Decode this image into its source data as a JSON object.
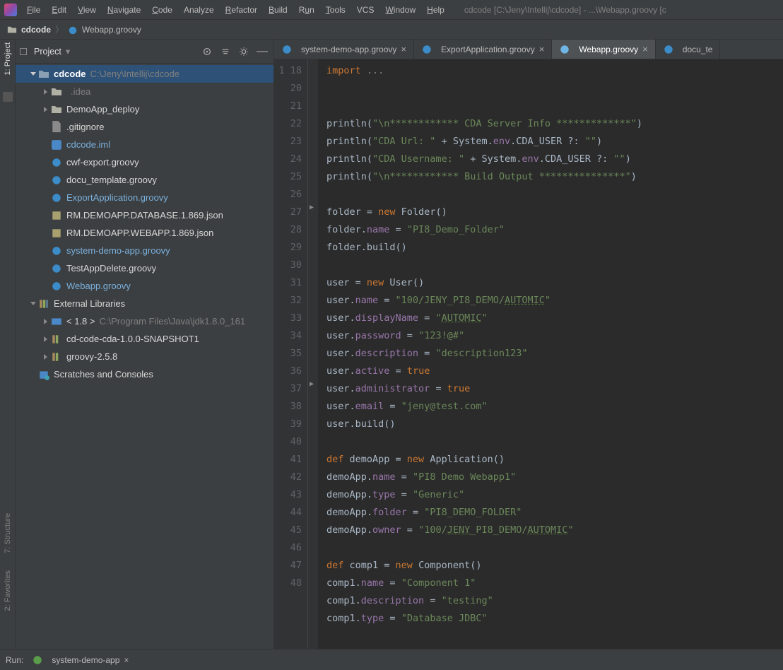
{
  "menu": {
    "file": "File",
    "edit": "Edit",
    "view": "View",
    "navigate": "Navigate",
    "code": "Code",
    "analyze": "Analyze",
    "refactor": "Refactor",
    "build": "Build",
    "run": "Run",
    "tools": "Tools",
    "vcs": "VCS",
    "window": "Window",
    "help": "Help",
    "title_path": "cdcode [C:\\Jeny\\Intellij\\cdcode] - ...\\Webapp.groovy [c"
  },
  "breadcrumb": {
    "project": "cdcode",
    "file": "Webapp.groovy"
  },
  "left_tabs": {
    "project": "1: Project",
    "structure": "7: Structure",
    "favorites": "2: Favorites"
  },
  "project_panel": {
    "title": "Project"
  },
  "tree": {
    "root": {
      "name": "cdcode",
      "path": "C:\\Jeny\\Intellij\\cdcode"
    },
    "items": [
      {
        "label": ".idea",
        "type": "folder",
        "exp": true
      },
      {
        "label": "DemoApp_deploy",
        "type": "folder",
        "exp": true
      },
      {
        "label": ".gitignore",
        "type": "file"
      },
      {
        "label": "cdcode.iml",
        "type": "iml",
        "hl": true
      },
      {
        "label": "cwf-export.groovy",
        "type": "groovy"
      },
      {
        "label": "docu_template.groovy",
        "type": "groovy"
      },
      {
        "label": "ExportApplication.groovy",
        "type": "groovy",
        "hl": true
      },
      {
        "label": "RM.DEMOAPP.DATABASE.1.869.json",
        "type": "json"
      },
      {
        "label": "RM.DEMOAPP.WEBAPP.1.869.json",
        "type": "json"
      },
      {
        "label": "system-demo-app.groovy",
        "type": "groovy",
        "hl": true
      },
      {
        "label": "TestAppDelete.groovy",
        "type": "groovy"
      },
      {
        "label": "Webapp.groovy",
        "type": "groovy",
        "hl": true
      }
    ],
    "ext_lib": "External Libraries",
    "jdk": {
      "pre": "< 1.8 >",
      "path": "C:\\Program Files\\Java\\jdk1.8.0_161"
    },
    "lib1": "cd-code-cda-1.0.0-SNAPSHOT1",
    "lib2": "groovy-2.5.8",
    "scratches": "Scratches and Consoles"
  },
  "tabs": [
    {
      "label": "system-demo-app.groovy"
    },
    {
      "label": "ExportApplication.groovy"
    },
    {
      "label": "Webapp.groovy"
    },
    {
      "label": "docu_te"
    }
  ],
  "lines": [
    "1",
    "18",
    "",
    "20",
    "21",
    "22",
    "23",
    "24",
    "25",
    "26",
    "27",
    "28",
    "29",
    "30",
    "31",
    "32",
    "33",
    "34",
    "35",
    "36",
    "37",
    "38",
    "39",
    "40",
    "41",
    "42",
    "43",
    "44",
    "45",
    "46",
    "47",
    "48"
  ],
  "run": {
    "label": "Run:",
    "config": "system-demo-app"
  },
  "code_txt": {
    "import": "import",
    "dots": "...",
    "p1a": "println(",
    "p1b": "\"\\n************ CDA Server Info *************\"",
    "p2a": "println(",
    "p2b": "\"CDA Url: \"",
    "p2c": " + System.",
    "p2env": "env",
    "p2d": ".CDA_USER ?: ",
    "p2e": "\"\"",
    "p3a": "println(",
    "p3b": "\"CDA Username: \"",
    "p3c": " + System.",
    "p3env": "env",
    "p3d": ".CDA_USER ?: ",
    "p3e": "\"\"",
    "p4a": "println(",
    "p4b": "\"\\n************ Build Output ***************\"",
    "folder_a": "folder = ",
    "new": "new",
    "folder_b": " Folder()",
    "fname_a": "folder.",
    "fname_f": "name",
    "fname_b": " = ",
    "fname_s": "\"PI8_Demo_Folder\"",
    "fbuild": "folder.build()",
    "user_a": "user = ",
    "user_b": " User()",
    "un_a": "user.",
    "un_f": "name",
    "un_b": " = ",
    "un_s": "\"100/JENY_PI8_DEMO/",
    "un_l": "AUTOMIC",
    "un_e": "\"",
    "ud_a": "user.",
    "ud_f": "displayName",
    "ud_b": " = ",
    "ud_s": "\"",
    "ud_l": "AUTOMIC",
    "ud_e": "\"",
    "up_a": "user.",
    "up_f": "password",
    "up_b": " = ",
    "up_s": "\"123!@#\"",
    "ude_a": "user.",
    "ude_f": "description",
    "ude_b": " = ",
    "ude_s": "\"description123\"",
    "ua_a": "user.",
    "ua_f": "active",
    "ua_b": " = ",
    "true": "true",
    "uad_a": "user.",
    "uad_f": "administrator",
    "uad_b": " = ",
    "ue_a": "user.",
    "ue_f": "email",
    "ue_b": " = ",
    "ue_s": "\"jeny@test.com\"",
    "ubuild": "user.build()",
    "def": "def",
    "da_a": " demoApp = ",
    "da_b": " Application()",
    "dan_a": "demoApp.",
    "dan_f": "name",
    "dan_b": " = ",
    "dan_s": "\"PI8 Demo Webapp1\"",
    "dat_a": "demoApp.",
    "dat_f": "type",
    "dat_b": " = ",
    "dat_s": "\"Generic\"",
    "daf_a": "demoApp.",
    "daf_f": "folder",
    "daf_b": " = ",
    "daf_s": "\"PI8_DEMO_FOLDER\"",
    "dao_a": "demoApp.",
    "dao_f": "owner",
    "dao_b": " = ",
    "dao_s": "\"100/",
    "dao_l1": "JENY",
    "dao_m": "_PI8_DEMO/",
    "dao_l2": "AUTOMIC",
    "dao_e": "\"",
    "c1_a": " comp1 = ",
    "c1_b": " Component()",
    "c1n_a": "comp1.",
    "c1n_f": "name",
    "c1n_b": " = ",
    "c1n_s": "\"Component 1\"",
    "c1d_a": "comp1.",
    "c1d_f": "description",
    "c1d_b": " = ",
    "c1d_s": "\"testing\"",
    "c1t_a": "comp1.",
    "c1t_f": "type",
    "c1t_b": " = ",
    "c1t_s": "\"Database JDBC\""
  }
}
